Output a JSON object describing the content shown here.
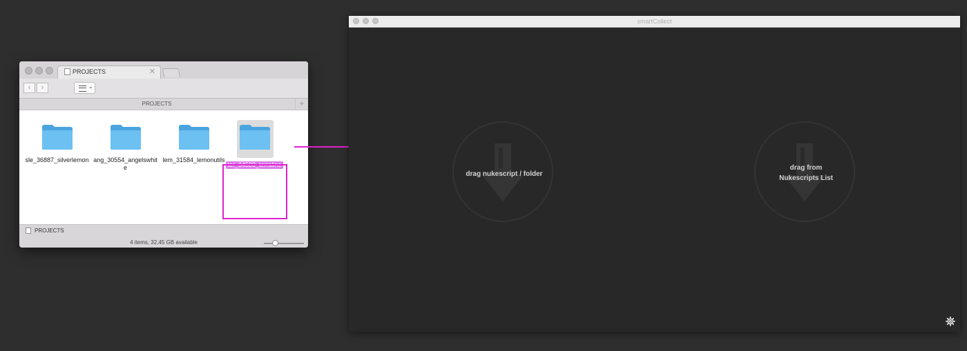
{
  "finder": {
    "tab_title": "PROJECTS",
    "tab_close": "✕",
    "back_label": "‹",
    "forward_label": "›",
    "view_chevron": "⌄",
    "path_label": "PROJECTS",
    "add_label": "+",
    "items": [
      {
        "name": "sle_36887_silverlemon"
      },
      {
        "name": "ang_30554_angelswhite"
      },
      {
        "name": "lem_31584_lemonutils"
      },
      {
        "name": "ter_34523_terraline"
      }
    ],
    "status_location": "PROJECTS",
    "status_text": "4 items, 32,45 GB available",
    "icon_size_slider_value": 0.25
  },
  "smartcollect": {
    "window_title": "smartCollect",
    "drop_left_label": "drag nukescript / folder",
    "drop_right_line1": "drag from",
    "drop_right_line2": "Nukescripts List"
  },
  "colors": {
    "folder_blue": "#62b7ec",
    "selection_magenta": "#e020d0",
    "selected_label_bg": "#d97de8",
    "app_bg": "#282828"
  },
  "icons": [
    "folder-icon",
    "settings-gear-icon",
    "drop-download-icon",
    "arrow-right-icon"
  ]
}
